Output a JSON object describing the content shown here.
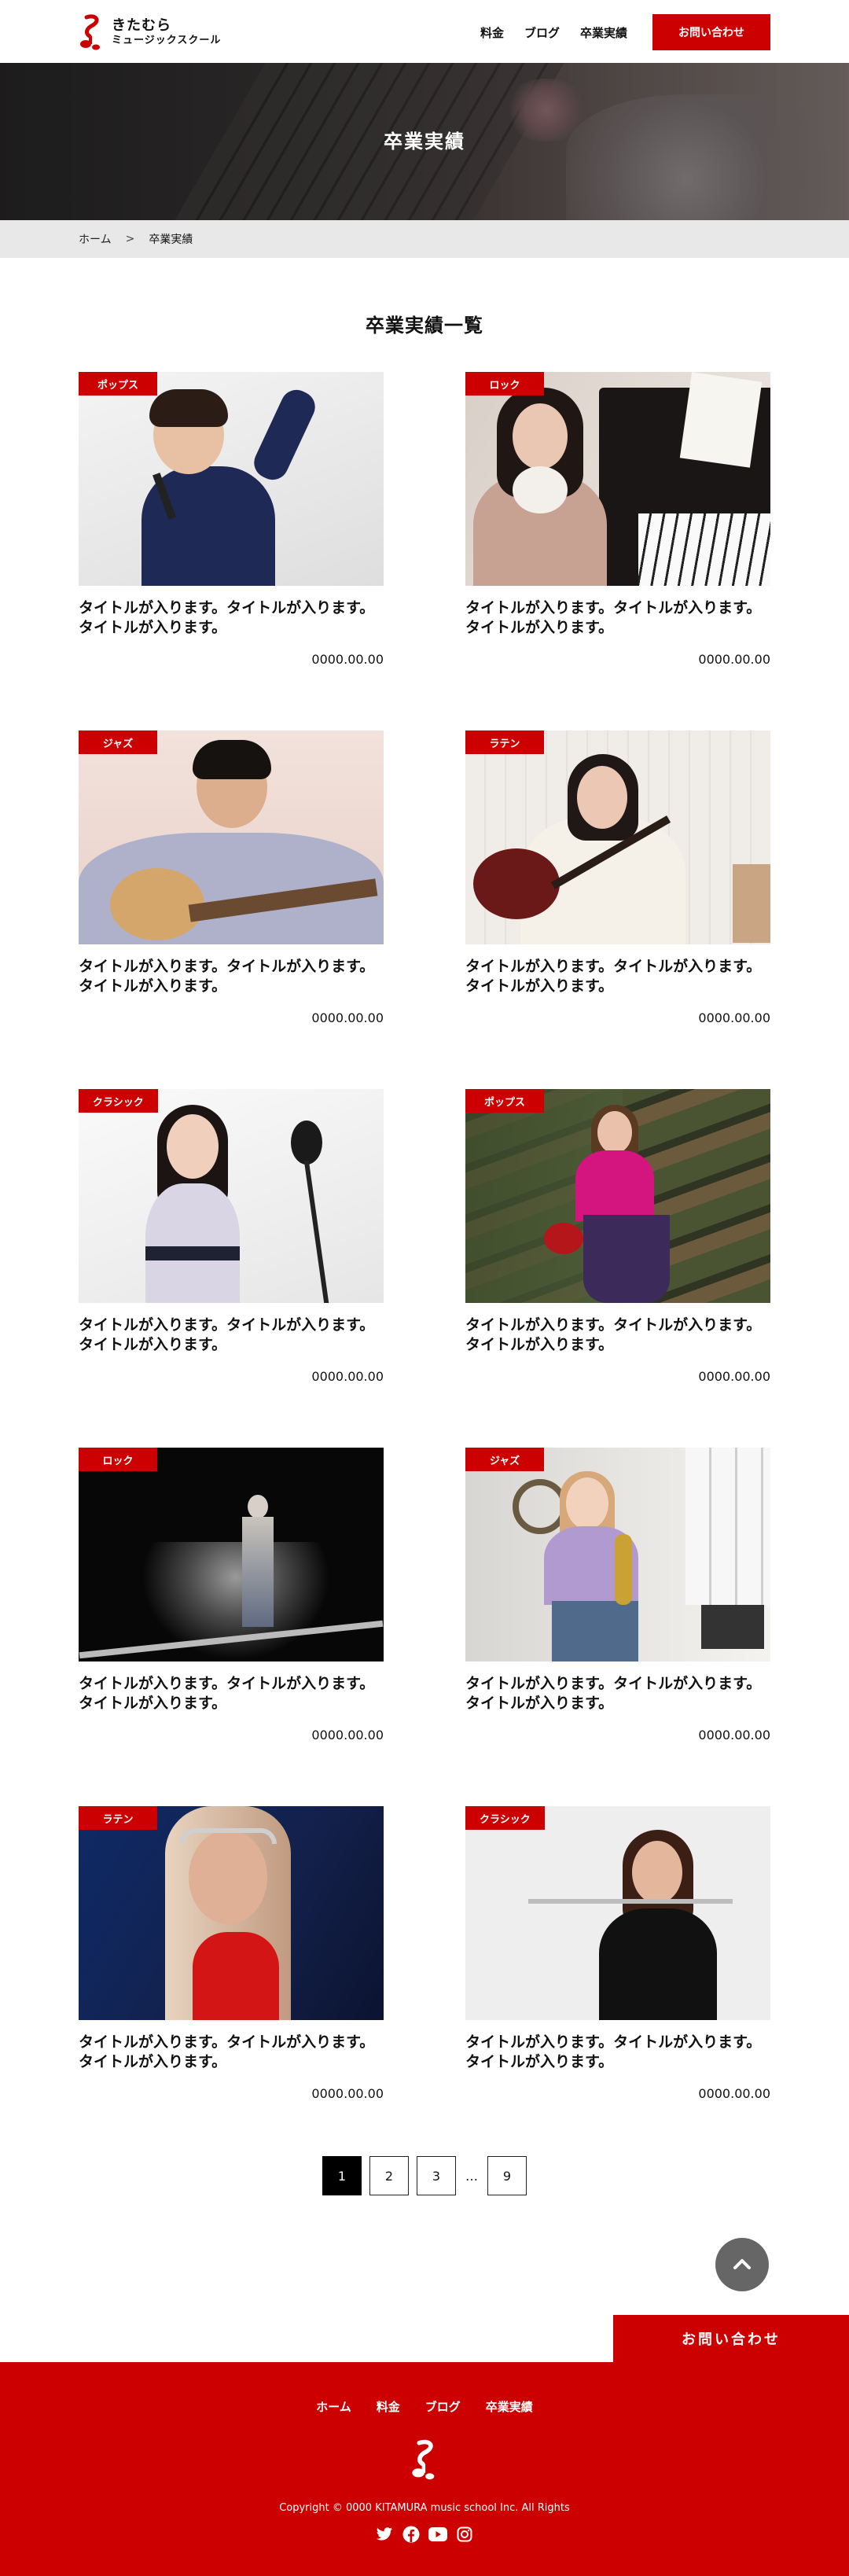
{
  "header": {
    "logo_title": "きたむら",
    "logo_sub": "ミュージックスクール",
    "nav": [
      "料金",
      "ブログ",
      "卒業実績"
    ],
    "contact": "お問い合わせ"
  },
  "hero": {
    "title": "卒業実績"
  },
  "breadcrumb": {
    "home": "ホーム",
    "sep": ">",
    "current": "卒業実績"
  },
  "section": {
    "title": "卒業実績一覧"
  },
  "cards": [
    {
      "tag": "ポップス",
      "title": "タイトルが入ります。タイトルが入ります。タイトルが入ります。",
      "date": "0000.00.00"
    },
    {
      "tag": "ロック",
      "title": "タイトルが入ります。タイトルが入ります。タイトルが入ります。",
      "date": "0000.00.00"
    },
    {
      "tag": "ジャズ",
      "title": "タイトルが入ります。タイトルが入ります。タイトルが入ります。",
      "date": "0000.00.00"
    },
    {
      "tag": "ラテン",
      "title": "タイトルが入ります。タイトルが入ります。タイトルが入ります。",
      "date": "0000.00.00"
    },
    {
      "tag": "クラシック",
      "title": "タイトルが入ります。タイトルが入ります。タイトルが入ります。",
      "date": "0000.00.00"
    },
    {
      "tag": "ポップス",
      "title": "タイトルが入ります。タイトルが入ります。タイトルが入ります。",
      "date": "0000.00.00"
    },
    {
      "tag": "ロック",
      "title": "タイトルが入ります。タイトルが入ります。タイトルが入ります。",
      "date": "0000.00.00"
    },
    {
      "tag": "ジャズ",
      "title": "タイトルが入ります。タイトルが入ります。タイトルが入ります。",
      "date": "0000.00.00"
    },
    {
      "tag": "ラテン",
      "title": "タイトルが入ります。タイトルが入ります。タイトルが入ります。",
      "date": "0000.00.00"
    },
    {
      "tag": "クラシック",
      "title": "タイトルが入ります。タイトルが入ります。タイトルが入ります。",
      "date": "0000.00.00"
    }
  ],
  "pagination": {
    "pages": [
      "1",
      "2",
      "3",
      "9"
    ],
    "ellipsis": "…",
    "current": "1"
  },
  "float_contact": "お問い合わせ",
  "footer": {
    "nav": [
      "ホーム",
      "料金",
      "ブログ",
      "卒業実績"
    ],
    "copyright": "Copyright © 0000 KITAMURA music school Inc. All Rights",
    "social_icons": [
      "twitter-icon",
      "facebook-icon",
      "youtube-icon",
      "instagram-icon"
    ]
  },
  "colors": {
    "accent": "#cc0000",
    "breadcrumb_bg": "#e8e8e8",
    "to_top": "#666666"
  }
}
